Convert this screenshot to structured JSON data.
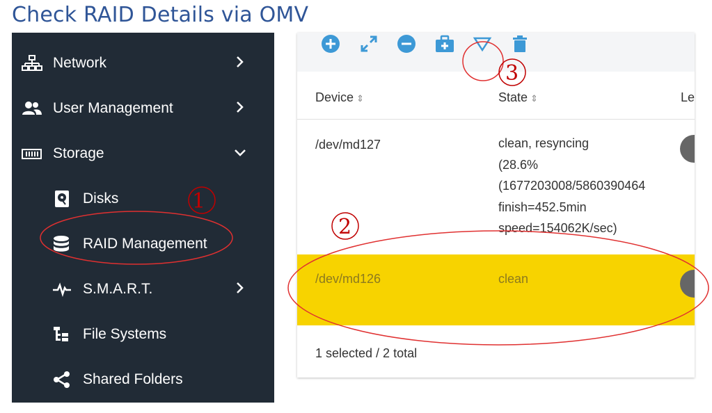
{
  "slide": {
    "title": "Check RAID Details via OMV"
  },
  "sidebar": {
    "items": [
      {
        "label": "Network",
        "icon": "network-icon"
      },
      {
        "label": "User Management",
        "icon": "users-icon"
      },
      {
        "label": "Storage",
        "icon": "storage-icon"
      },
      {
        "label": "Disks",
        "icon": "disk-icon"
      },
      {
        "label": "RAID Management",
        "icon": "database-icon"
      },
      {
        "label": "S.M.A.R.T.",
        "icon": "pulse-icon"
      },
      {
        "label": "File Systems",
        "icon": "tree-icon"
      },
      {
        "label": "Shared Folders",
        "icon": "share-icon"
      }
    ]
  },
  "toolbar": {
    "buttons": [
      "add-icon",
      "expand-icon",
      "remove-icon",
      "medkit-icon",
      "filter-icon",
      "trash-icon"
    ]
  },
  "table": {
    "columns": [
      "Device",
      "State",
      "Le"
    ],
    "rows": [
      {
        "device": "/dev/md127",
        "state_lines": [
          "clean, resyncing",
          "(28.6%",
          "(1677203008/5860390464",
          "finish=452.5min",
          "speed=154062K/sec)"
        ]
      },
      {
        "device": "/dev/md126",
        "state_lines": [
          "clean"
        ],
        "selected": true
      }
    ],
    "footer": "1 selected / 2 total"
  },
  "annotations": {
    "labels": [
      "1",
      "2",
      "3"
    ],
    "color": "#C00000"
  },
  "colors": {
    "sidebar_bg": "#212B36",
    "accent_blue": "#3D99D6",
    "selected_row": "#F7D300",
    "title": "#2F5597"
  }
}
